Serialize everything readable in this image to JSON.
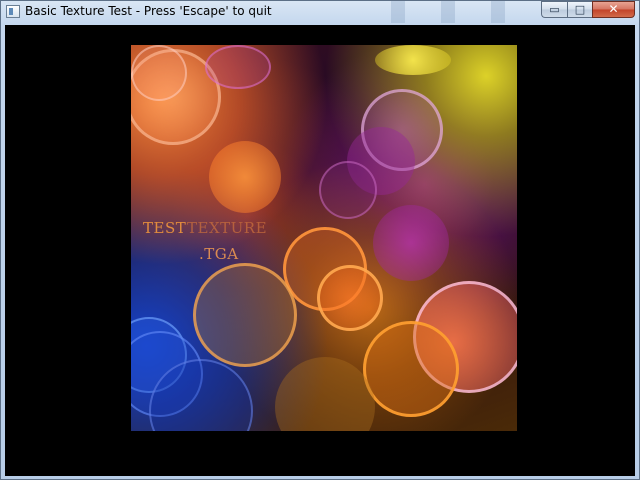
{
  "window": {
    "title": "Basic Texture Test - Press 'Escape' to quit",
    "caption_buttons": {
      "minimize": "▭",
      "maximize": "□",
      "close": "✕"
    }
  },
  "texture": {
    "text_word1": "TEST",
    "text_word2": "TEXTURE",
    "text_ext": ".TGA"
  },
  "colors": {
    "client_background": "#000000",
    "bubble_orange": "#ff8a30",
    "bubble_purple": "#b02cb8",
    "bubble_yellow": "#e6dc28",
    "bubble_blue": "#1e46d2"
  }
}
